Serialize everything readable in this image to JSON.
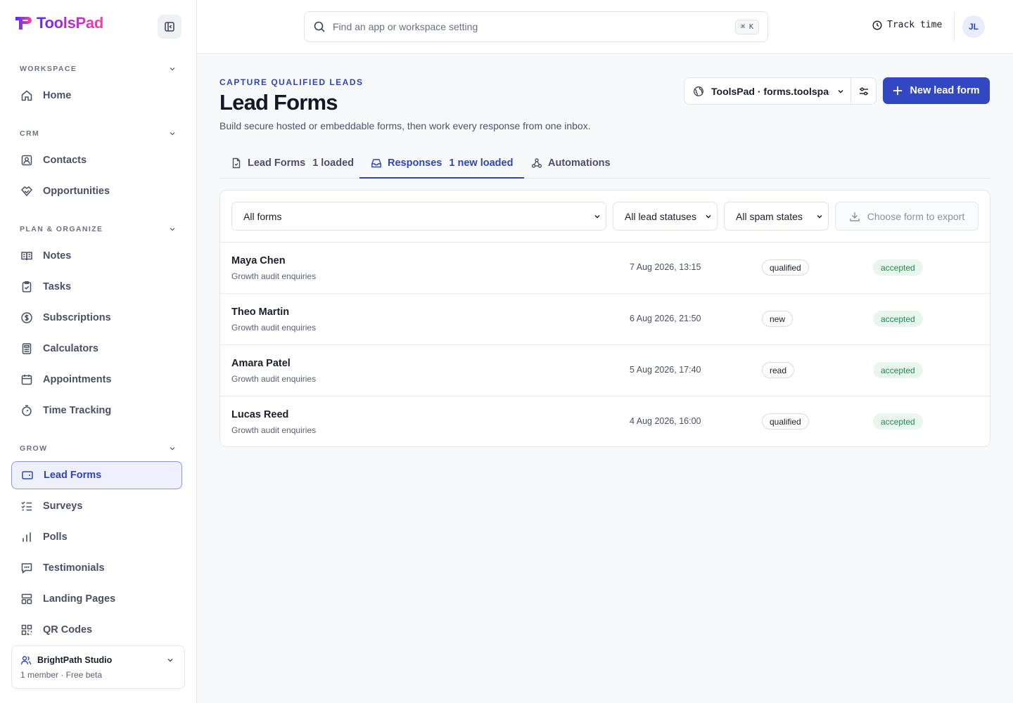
{
  "app": {
    "name": "ToolsPad",
    "accent": "#3148c2"
  },
  "sidebar": {
    "sections": [
      {
        "label": "WORKSPACE",
        "items": [
          {
            "label": "Home",
            "icon": "home-icon"
          }
        ]
      },
      {
        "label": "CRM",
        "items": [
          {
            "label": "Contacts",
            "icon": "contacts-icon"
          },
          {
            "label": "Opportunities",
            "icon": "opportunities-icon"
          }
        ]
      },
      {
        "label": "PLAN & ORGANIZE",
        "items": [
          {
            "label": "Notes",
            "icon": "notes-icon"
          },
          {
            "label": "Tasks",
            "icon": "tasks-icon"
          },
          {
            "label": "Subscriptions",
            "icon": "dollar-icon"
          },
          {
            "label": "Calculators",
            "icon": "calculator-icon"
          },
          {
            "label": "Appointments",
            "icon": "calendar-icon"
          },
          {
            "label": "Time Tracking",
            "icon": "timer-icon"
          }
        ]
      },
      {
        "label": "GROW",
        "items": [
          {
            "label": "Lead Forms",
            "icon": "form-icon",
            "active": true
          },
          {
            "label": "Surveys",
            "icon": "checklist-icon"
          },
          {
            "label": "Polls",
            "icon": "bar-chart-icon"
          },
          {
            "label": "Testimonials",
            "icon": "quote-icon"
          },
          {
            "label": "Landing Pages",
            "icon": "layout-icon"
          },
          {
            "label": "QR Codes",
            "icon": "qr-icon"
          }
        ]
      }
    ],
    "workspace": {
      "name": "BrightPath Studio",
      "meta": "1 member · Free beta"
    }
  },
  "topbar": {
    "search_placeholder": "Find an app or workspace setting",
    "search_shortcut": "⌘ K",
    "track_time": "Track time",
    "avatar_initials": "JL"
  },
  "header": {
    "eyebrow": "CAPTURE QUALIFIED LEADS",
    "title": "Lead Forms",
    "subtitle": "Build secure hosted or embeddable forms, then work every response from one inbox.",
    "site_selector": "ToolsPad · forms.toolspad",
    "new_button": "New lead form"
  },
  "tabs": [
    {
      "label": "Lead Forms",
      "count": "1 loaded",
      "icon": "file-icon"
    },
    {
      "label": "Responses",
      "count": "1 new loaded",
      "icon": "inbox-icon",
      "active": true
    },
    {
      "label": "Automations",
      "icon": "webhook-icon"
    }
  ],
  "filters": {
    "form": "All forms",
    "status": "All lead statuses",
    "spam": "All spam states",
    "export": "Choose form to export"
  },
  "responses": [
    {
      "name": "Maya Chen",
      "form": "Growth audit enquiries",
      "date": "7 Aug 2026, 13:15",
      "status": "qualified",
      "spam": "accepted"
    },
    {
      "name": "Theo Martin",
      "form": "Growth audit enquiries",
      "date": "6 Aug 2026, 21:50",
      "status": "new",
      "spam": "accepted"
    },
    {
      "name": "Amara Patel",
      "form": "Growth audit enquiries",
      "date": "5 Aug 2026, 17:40",
      "status": "read",
      "spam": "accepted"
    },
    {
      "name": "Lucas Reed",
      "form": "Growth audit enquiries",
      "date": "4 Aug 2026, 16:00",
      "status": "qualified",
      "spam": "accepted"
    }
  ]
}
